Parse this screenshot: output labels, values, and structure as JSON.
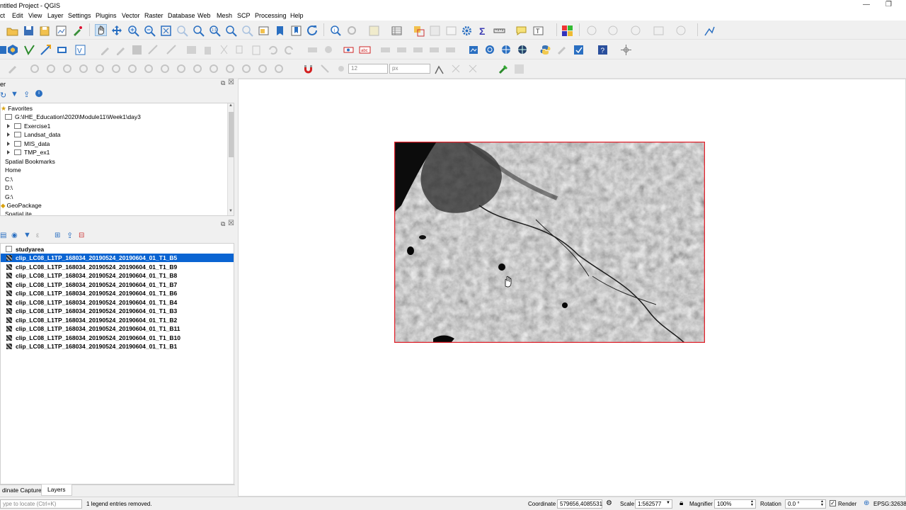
{
  "window": {
    "title": "ntitled Project - QGIS",
    "minimize_glyph": "—",
    "restore_glyph": "❐"
  },
  "menubar": [
    "ct",
    "Edit",
    "View",
    "Layer",
    "Settings",
    "Plugins",
    "Vector",
    "Raster",
    "Database",
    "Web",
    "Mesh",
    "SCP",
    "Processing",
    "Help"
  ],
  "digitizing": {
    "snap_tolerance": "12",
    "snap_unit": "px"
  },
  "browser": {
    "title": "er",
    "items": {
      "favorites": "Favorites",
      "path": "G:\\IHE_Education\\2020\\Module11\\Week1\\day3",
      "exercise1": "Exercise1",
      "landsat": "Landsat_data",
      "mis": "MIS_data",
      "tmp": "TMP_ex1",
      "bookmarks": "Spatial Bookmarks",
      "home": "Home",
      "c": "C:\\",
      "d": "D:\\",
      "g": "G:\\",
      "geopackage": "GeoPackage",
      "spatialite": "SpatiaLite"
    }
  },
  "layers": {
    "group": "studyarea",
    "items": [
      "clip_LC08_L1TP_168034_20190524_20190604_01_T1_B5",
      "clip_LC08_L1TP_168034_20190524_20190604_01_T1_B9",
      "clip_LC08_L1TP_168034_20190524_20190604_01_T1_B8",
      "clip_LC08_L1TP_168034_20190524_20190604_01_T1_B7",
      "clip_LC08_L1TP_168034_20190524_20190604_01_T1_B6",
      "clip_LC08_L1TP_168034_20190524_20190604_01_T1_B4",
      "clip_LC08_L1TP_168034_20190524_20190604_01_T1_B3",
      "clip_LC08_L1TP_168034_20190524_20190604_01_T1_B2",
      "clip_LC08_L1TP_168034_20190524_20190604_01_T1_B11",
      "clip_LC08_L1TP_168034_20190524_20190604_01_T1_B10",
      "clip_LC08_L1TP_168034_20190524_20190604_01_T1_B1"
    ]
  },
  "bottom_tabs": {
    "capture": "dinate Capture",
    "layers": "Layers"
  },
  "status": {
    "locate_placeholder": "ype to locate (Ctrl+K)",
    "message": "1 legend entries removed.",
    "coordinate_label": "Coordinate",
    "coordinate_value": "579656,4085531",
    "scale_label": "Scale",
    "scale_value": "1:562577",
    "magnifier_label": "Magnifier",
    "magnifier_value": "100%",
    "rotation_label": "Rotation",
    "rotation_value": "0.0 °",
    "render_label": "Render",
    "crs": "EPSG:32638"
  },
  "colors": {
    "selection": "#0a64d2",
    "map_frame": "#e0202a",
    "accent_blue": "#1f6fc9"
  }
}
